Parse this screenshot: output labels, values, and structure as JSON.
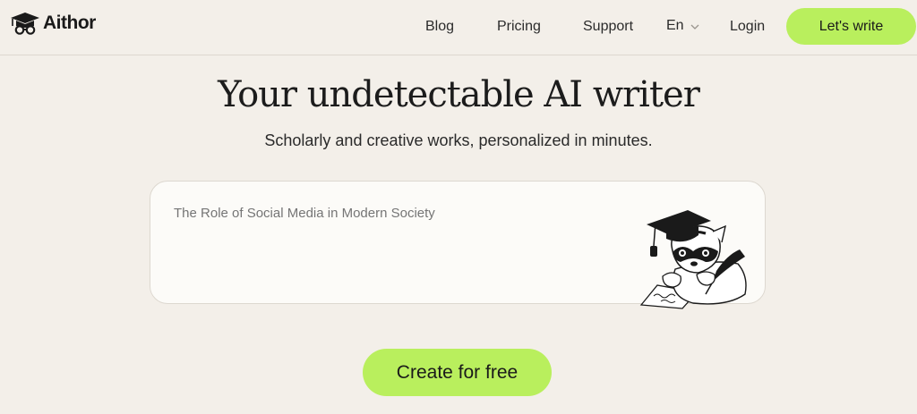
{
  "brand": {
    "name": "Aithor"
  },
  "nav": {
    "links": [
      "Blog",
      "Pricing",
      "Support"
    ],
    "language": "En",
    "login": "Login",
    "cta": "Let's write"
  },
  "hero": {
    "title": "Your undetectable AI writer",
    "subtitle": "Scholarly and creative works, personalized in minutes.",
    "input_placeholder": "The Role of Social Media in Modern Society",
    "cta": "Create for free"
  },
  "colors": {
    "background": "#f3efe9",
    "accent": "#b9ef5d",
    "card": "#fcfbf8"
  },
  "icons": {
    "logo": "graduation-cap-glasses-icon",
    "language_chevron": "chevron-down-icon",
    "mascot": "raccoon-graduate-writing-illustration"
  }
}
